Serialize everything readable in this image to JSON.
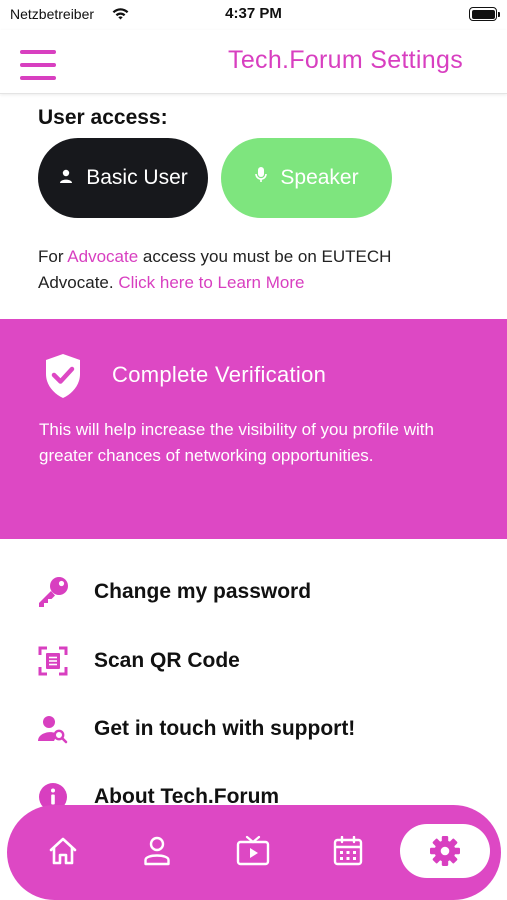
{
  "status_bar": {
    "carrier": "Netzbetreiber",
    "time": "4:37 PM",
    "icons": [
      "wifi-icon",
      "battery-icon"
    ]
  },
  "header": {
    "menu_icon": "hamburger-icon",
    "title": "Tech.Forum Settings"
  },
  "user_access": {
    "label": "User access:",
    "roles": [
      {
        "label": "Basic User",
        "icon": "person-icon",
        "bg": "#17181c"
      },
      {
        "label": "Speaker",
        "icon": "microphone-icon",
        "bg": "#7ee57e"
      }
    ],
    "note": {
      "prefix": "For ",
      "advocate_link": "Advocate",
      "middle": " access you must be on EUTECH Advocate. ",
      "learn_more_link": "Click here to Learn More"
    }
  },
  "verification": {
    "icon": "shield-check-icon",
    "title": "Complete Verification",
    "description": "This will help increase the visibility of you profile with greater chances of networking opportunities.",
    "bg": "#dd48c4"
  },
  "settings_menu": [
    {
      "label": "Change my password",
      "icon": "key-icon"
    },
    {
      "label": "Scan QR Code",
      "icon": "qr-scan-icon"
    },
    {
      "label": "Get in touch with support!",
      "icon": "person-search-icon"
    },
    {
      "label": "About Tech.Forum",
      "icon": "info-icon"
    }
  ],
  "bottom_nav": {
    "items": [
      "home-icon",
      "profile-icon",
      "tv-icon",
      "calendar-icon",
      "settings-gear-icon"
    ],
    "active": "settings-gear-icon"
  },
  "colors": {
    "accent": "#d83fc0",
    "panel": "#dd48c4",
    "dark_button": "#17181c",
    "speaker_button": "#7ee57e"
  }
}
